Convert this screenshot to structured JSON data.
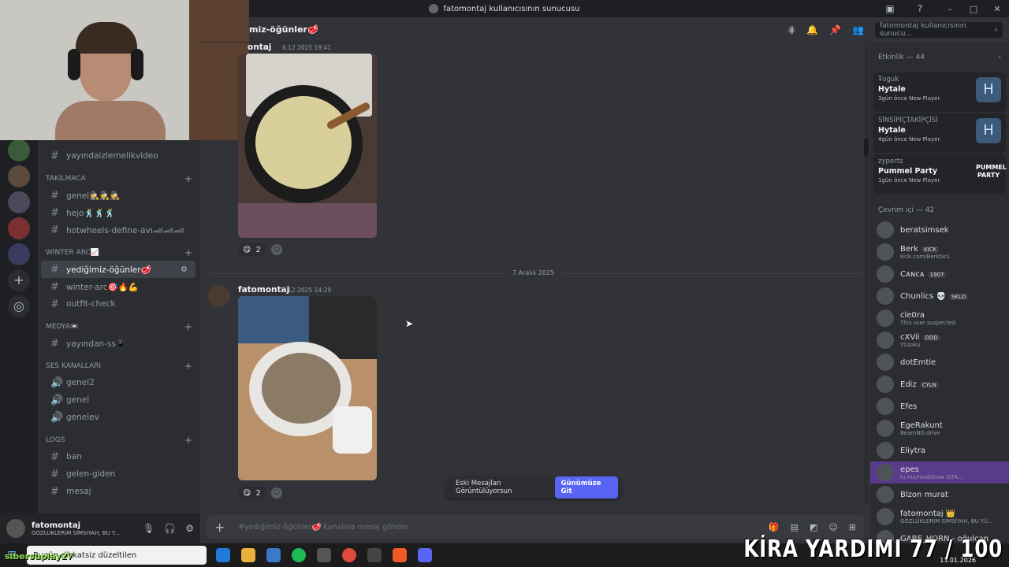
{
  "window": {
    "title": "fatomontaj kullanıcısının sunucusu"
  },
  "channels": {
    "top_channel": "yayındaizlemelikvideo",
    "categories": [
      {
        "name": "TAKILMACA",
        "items": [
          "genel🕵🕵🕵",
          "hejo🕺🕺🕺",
          "hotwheels-define-avı🏎🏎🏎"
        ]
      },
      {
        "name": "WINTER ARC📈",
        "items": [
          "yediğimiz-öğünler🥩",
          "winter-arc🎯🔥💪",
          "outfit-check"
        ]
      },
      {
        "name": "MEDYA📼",
        "items": [
          "yayından-ss📱"
        ]
      },
      {
        "name": "Ses Kanalları",
        "items": [
          "genel2",
          "genel",
          "genelev"
        ]
      },
      {
        "name": "LOGS",
        "items": [
          "ban",
          "gelen-giden",
          "mesaj"
        ]
      }
    ]
  },
  "user": {
    "name": "fatomontaj",
    "status": "GÖZLÜKLERİM SİMSİYAH, BU Y..."
  },
  "header": {
    "channel": "miz-öğünler🥩",
    "search_placeholder": "fatomontaj kullanıcısının sunucu..."
  },
  "messages": [
    {
      "author": "ontaj",
      "time": "6.12.2025 19:41",
      "reaction_count": "2"
    },
    {
      "author": "fatomontaj",
      "time": "7.12.2025 14:29",
      "reaction_count": "2"
    }
  ],
  "date_divider": "7 Aralık 2025",
  "jump_bar": {
    "text": "Eski Mesajları Görüntülüyorsun",
    "button": "Günümüze Git"
  },
  "composer": {
    "placeholder": "#yediğimiz-öğünler🥩 kanalına mesaj gönder"
  },
  "activity": {
    "header": "Etkinlik — 44",
    "cards": [
      {
        "who": "Ŧoǥuk",
        "game": "Hytale",
        "meta": "3gün önce  New Player"
      },
      {
        "who": "SİNSİPİÇTAKİPÇİSİ",
        "game": "Hytale",
        "meta": "4gün önce  New Player"
      },
      {
        "who": "zyperts",
        "game": "Pummel Party",
        "meta": "1gün önce  New Player"
      }
    ]
  },
  "members": {
    "header": "Çevrim içi — 42",
    "list": [
      {
        "name": "beratsimsek",
        "tag": "",
        "sub": ""
      },
      {
        "name": "Berk",
        "tag": "KICK",
        "sub": "kick.com/Berkbir1"
      },
      {
        "name": "Cᴀɴᴄᴀ",
        "tag": "1907",
        "sub": ""
      },
      {
        "name": "Chunlics 💀",
        "tag": "SKLD",
        "sub": ""
      },
      {
        "name": "cle0ra",
        "tag": "",
        "sub": "This user suspected."
      },
      {
        "name": "cXVii",
        "tag": "DDD",
        "sub": "YUzaku"
      },
      {
        "name": "dotEmtie",
        "tag": "",
        "sub": ""
      },
      {
        "name": "Ediz",
        "tag": "CYLN",
        "sub": ""
      },
      {
        "name": "Efes",
        "tag": "",
        "sub": ""
      },
      {
        "name": "EgeRakunt",
        "tag": "",
        "sub": "BeamNG.drive"
      },
      {
        "name": "Eliytra",
        "tag": "",
        "sub": ""
      },
      {
        "name": "epes",
        "tag": "",
        "sub": "lu.ma/roadshow ISTA..."
      },
      {
        "name": "Blzon murat",
        "tag": "",
        "sub": ""
      },
      {
        "name": "fatomontaj 👑",
        "tag": "",
        "sub": "GÖZLÜKLERİM SİMSİYAH, BU YÜ..."
      },
      {
        "name": "GABE_HORN - oğulcan",
        "tag": "",
        "sub": ""
      }
    ]
  },
  "taskbar": {
    "search": "Bugün dikkatsiz düzeltilen"
  },
  "overlay": {
    "title": "KİRA YARDIMI 77 / 100",
    "streamer": "sibersuplay27",
    "date": "13.01.2026"
  }
}
